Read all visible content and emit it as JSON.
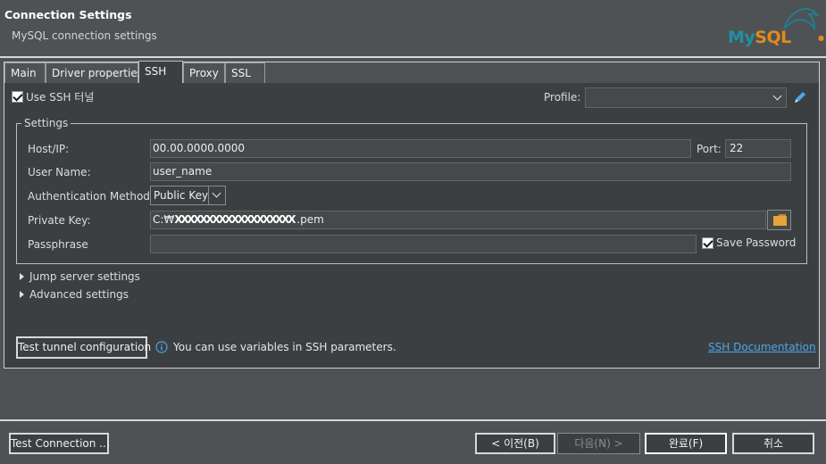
{
  "header": {
    "title": "Connection Settings",
    "subtitle": "MySQL connection settings",
    "logo_text_my": "My",
    "logo_text_sql": "SQL",
    "logo_colors": {
      "my": "#1f8fa6",
      "sql": "#e08a1e"
    }
  },
  "tabs": [
    {
      "label": "Main",
      "active": false
    },
    {
      "label": "Driver properties",
      "active": false
    },
    {
      "label": "SSH",
      "active": true
    },
    {
      "label": "Proxy",
      "active": false
    },
    {
      "label": "SSL",
      "active": false
    }
  ],
  "ssh": {
    "use_tunnel_label": "Use SSH 터널",
    "use_tunnel_checked": true,
    "profile_label": "Profile:",
    "profile_value": "",
    "edit_icon": "pencil-icon",
    "settings_legend": "Settings",
    "host_label": "Host/IP:",
    "host_value": "00.00.0000.0000",
    "port_label": "Port:",
    "port_value": "22",
    "user_label": "User Name:",
    "user_value": "user_name",
    "auth_label": "Authentication Method:",
    "auth_value": "Public Key",
    "key_label": "Private Key:",
    "key_prefix": "C:₩",
    "key_redacted": "XXXXXXXXXXXXXXXXXXX",
    "key_suffix": ".pem",
    "folder_icon": "folder-icon",
    "passphrase_label": "Passphrase",
    "passphrase_value": "",
    "save_password_label": "Save Password",
    "save_password_checked": true,
    "jump_label": "Jump server settings",
    "advanced_label": "Advanced settings",
    "test_tunnel_label": "Test tunnel configuration",
    "info_text": "You can use variables in SSH parameters.",
    "doc_link": "SSH Documentation",
    "accent_color": "#4aa6e8",
    "folder_color": "#e8a33a"
  },
  "footer": {
    "test_connection": "Test Connection ...",
    "back": "< 이전(B)",
    "next": "다음(N) >",
    "finish": "완료(F)",
    "cancel": "취소"
  }
}
